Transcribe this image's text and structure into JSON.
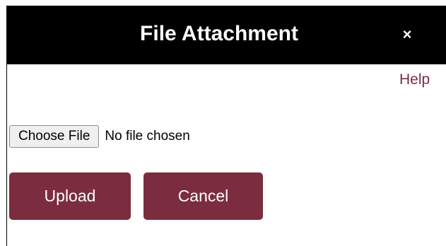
{
  "dialog": {
    "title": "File Attachment",
    "close_label": "×",
    "help_label": "Help"
  },
  "file_input": {
    "button_label": "Choose File",
    "status_text": "No file chosen"
  },
  "actions": {
    "upload_label": "Upload",
    "cancel_label": "Cancel"
  },
  "colors": {
    "titlebar_bg": "#000000",
    "accent": "#7b2d3e",
    "button_text": "#ffffff"
  },
  "icons": {
    "close": "close-icon"
  }
}
